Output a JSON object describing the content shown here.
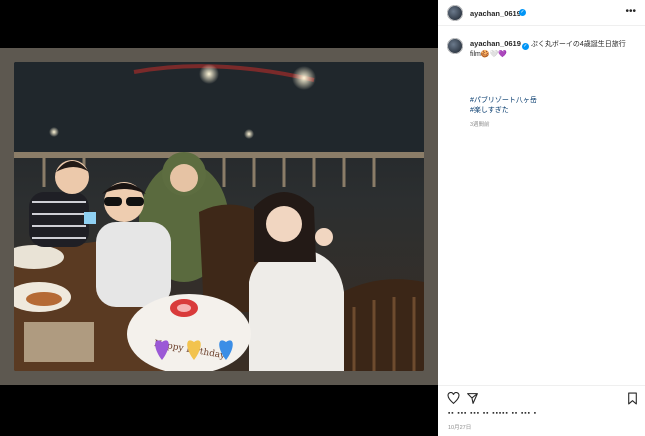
{
  "post": {
    "username": "ayachan_0619",
    "more_icon": "more-horizontal-icon",
    "caption_text": "ぷく丸ボーイの4歳誕生日旅行film",
    "caption_emojis": "🍪🤍💜",
    "hashtags": [
      "#パブリゾート八ヶ岳",
      "#楽しすぎた"
    ],
    "time_ago": "3週間前",
    "likes_text": "▪▪ ▪▪▪ ▪▪▪ ▪▪ ▪▪▪▪▪ ▪▪ ▪▪▪ ▪",
    "date": "10月27日"
  },
  "photo": {
    "plate_text": "Happy Birthday",
    "hearts": [
      "purple-heart",
      "yellow-heart",
      "blue-heart"
    ]
  },
  "colors": {
    "verified": "#0095f6",
    "hashtag": "#00376b",
    "frame": "#5d5850"
  }
}
